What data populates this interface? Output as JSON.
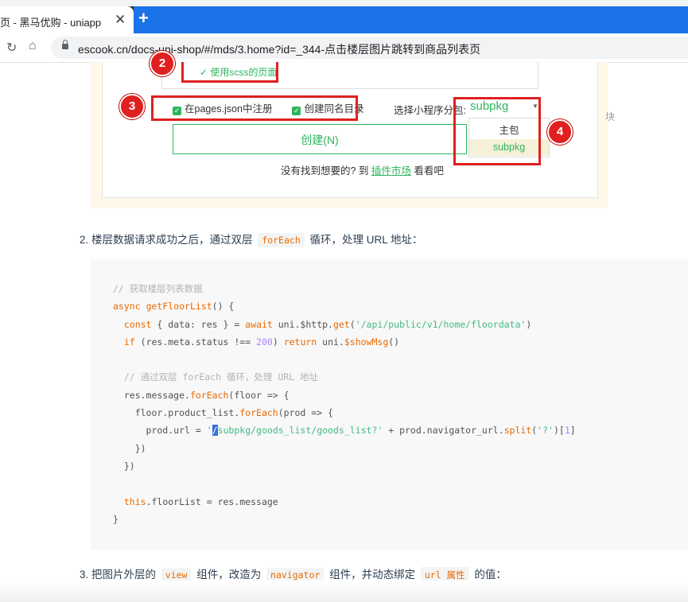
{
  "browser": {
    "tab_title": "页 - 黑马优购 - uniapp",
    "tab_close": "✕",
    "new_tab": "+",
    "url": "escook.cn/docs-uni-shop/#/mds/3.home?id=_344-点击楼层图片跳转到商品列表页"
  },
  "screenshot": {
    "scss_label": "✓ 使用scss的页面",
    "register_label": "在pages.json中注册",
    "same_dir_label": "创建同名目录",
    "subpkg_label": "选择小程序分包:",
    "subpkg_value": "subpkg",
    "side_char": "块",
    "options": [
      "主包",
      "subpkg"
    ],
    "create_button": "创建(N)",
    "not_found_prefix": "没有找到想要的? 到",
    "plugin_market": "插件市场",
    "not_found_suffix": "看看吧",
    "badges": [
      "2",
      "3",
      "4"
    ]
  },
  "step2": {
    "prefix": "2. 楼层数据请求成功之后，通过双层",
    "code": "forEach",
    "suffix": "循环，处理 URL 地址："
  },
  "code_lines": [
    "// 获取楼层列表数据",
    "async getFloorList() {",
    "  const { data: res } = await uni.$http.get('/api/public/v1/home/floordata')",
    "  if (res.meta.status !== 200) return uni.$showMsg()",
    "",
    "  // 通过双层 forEach 循环，处理 URL 地址",
    "  res.message.forEach(floor => {",
    "    floor.product_list.forEach(prod => {",
    "      prod.url = '/subpkg/goods_list/goods_list?' + prod.navigator_url.split('?')[1]",
    "    })",
    "  })",
    "",
    "  this.floorList = res.message",
    "}"
  ],
  "step3": {
    "prefix": "3. 把图片外层的",
    "code1": "view",
    "mid1": "组件，改造为",
    "code2": "navigator",
    "mid2": "组件，并动态绑定",
    "code3": "url 属性",
    "suffix": "的值："
  },
  "colors": {
    "accent_green": "#2db55d",
    "annotation_red": "#e02020",
    "code_orange": "#e96900",
    "code_string": "#42b983"
  }
}
